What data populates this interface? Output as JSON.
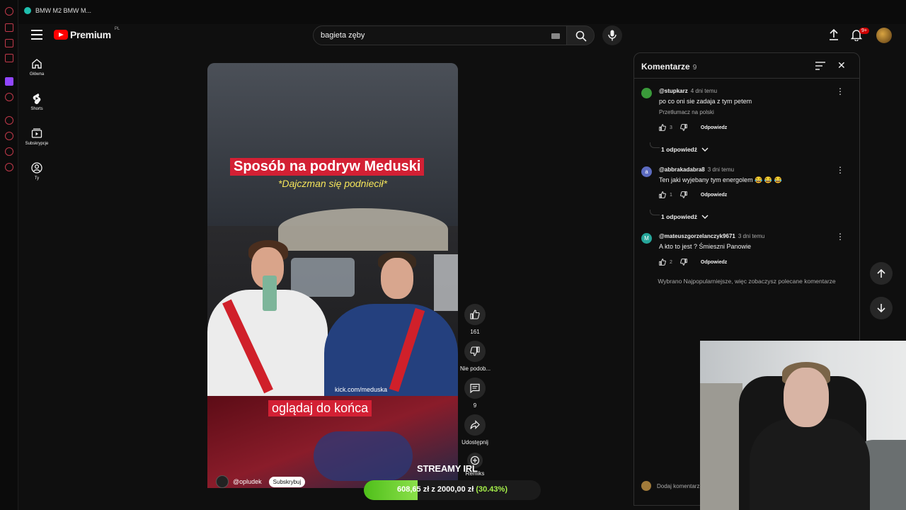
{
  "browser": {
    "tab_title": "BMW M2 BMW M..."
  },
  "header": {
    "logo_text": "Premium",
    "logo_region": "PL",
    "search_value": "bagieta zęby",
    "notifications_badge": "9+"
  },
  "sidebar": {
    "items": [
      {
        "label": "Główna",
        "icon": "home-icon"
      },
      {
        "label": "Shorts",
        "icon": "shorts-icon"
      },
      {
        "label": "Subskrypcje",
        "icon": "subscriptions-icon"
      },
      {
        "label": "Ty",
        "icon": "user-icon"
      }
    ]
  },
  "short": {
    "title_caption": "Sposób na podryw Meduski",
    "subtitle_caption": "*Dajczman się podniecił*",
    "watermark_link": "kick.com/meduska",
    "bottom_caption": "oglądaj do końca",
    "channel": "@opludek",
    "subscribe_label": "Subskrybuj"
  },
  "actions": {
    "like_count": "161",
    "dislike_label": "Nie podob...",
    "comments_count": "9",
    "share_label": "Udostępnij",
    "remix_label": "Remiks"
  },
  "comments": {
    "title": "Komentarze",
    "count": "9",
    "items": [
      {
        "author": "@stupkarz",
        "time": "4 dni temu",
        "text": "po co oni sie zadaja z tym petem",
        "translate": "Przetłumacz na polski",
        "likes": "3",
        "reply_label": "Odpowiedz",
        "replies_label": "1 odpowiedź",
        "avatar_color": "#3a9a3a"
      },
      {
        "author": "@abbrakadabra8",
        "time": "3 dni temu",
        "text": "Ten jaki wyjebany tym energolem 😂 😂 😂",
        "likes": "1",
        "reply_label": "Odpowiedz",
        "replies_label": "1 odpowiedź",
        "avatar_letter": "a",
        "avatar_color": "#5c6bc0"
      },
      {
        "author": "@mateuszgorzelanczyk9671",
        "time": "3 dni temu",
        "text": "A kto to jest ? Śmieszni Panowie",
        "likes": "2",
        "reply_label": "Odpowiedz",
        "avatar_letter": "M",
        "avatar_color": "#26a69a"
      }
    ],
    "sort_note": "Wybrano Najpopularniejsze, więc zobaczysz polecane komentarze",
    "add_comment_placeholder": "Dodaj komentarz..."
  },
  "overlay": {
    "brand": "STREAMY IRL",
    "donation_current": "608,65 zł",
    "donation_sep": "z",
    "donation_goal": "2000,00 zł",
    "donation_percent_label": "(30.43%)",
    "donation_progress": 0.3043
  },
  "colors": {
    "brand_red": "#ff0000",
    "caption_red": "#d32034",
    "progress_green": "#6fd13a"
  }
}
